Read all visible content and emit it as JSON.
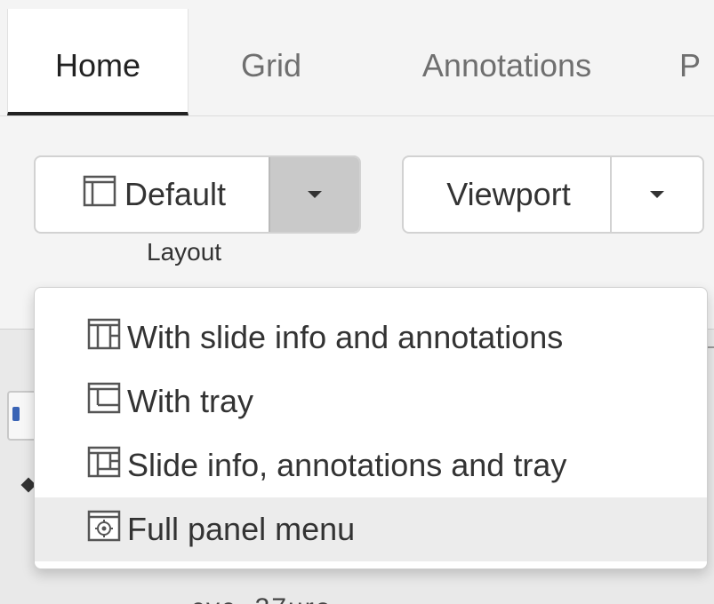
{
  "tabs": [
    {
      "id": "home",
      "label": "Home",
      "active": true
    },
    {
      "id": "grid",
      "label": "Grid",
      "active": false
    },
    {
      "id": "annotations",
      "label": "Annotations",
      "active": false
    },
    {
      "id": "more",
      "label": "P",
      "active": false
    }
  ],
  "toolbar": {
    "layout": {
      "button_label": "Default",
      "button_icon": "layout-default-icon",
      "caption": "Layout"
    },
    "viewport": {
      "button_label": "Viewport"
    }
  },
  "layout_menu": {
    "items": [
      {
        "label": "With slide info and annotations",
        "icon": "layout-info-annotations-icon"
      },
      {
        "label": "With tray",
        "icon": "layout-tray-icon"
      },
      {
        "label": "Slide info, annotations and tray",
        "icon": "layout-info-annotations-tray-icon"
      },
      {
        "label": "Full panel menu",
        "icon": "full-panel-menu-icon"
      }
    ]
  },
  "background": {
    "partial_text": "cvc..37ure"
  },
  "colors": {
    "active_tab_underline": "#222222",
    "caret_active_bg": "#c9c9c9",
    "menu_highlight": "#ececec"
  }
}
